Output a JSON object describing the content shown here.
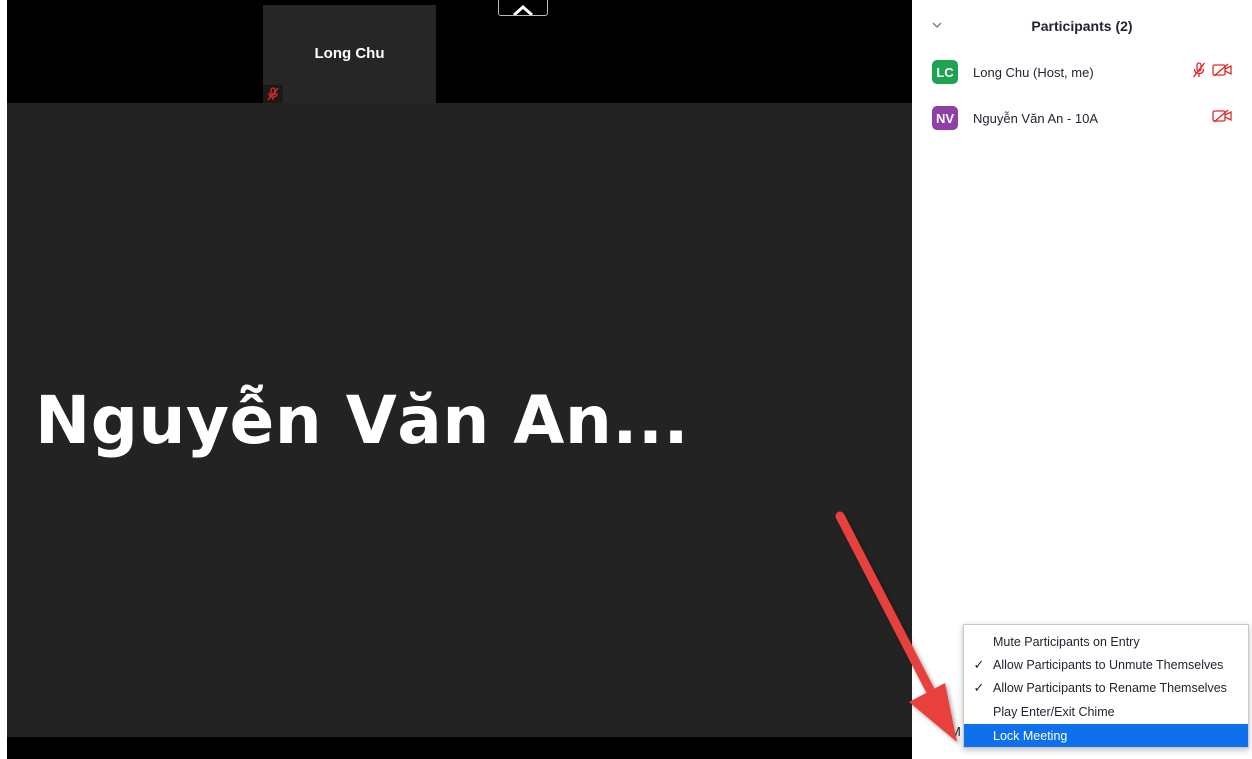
{
  "video": {
    "thumbnail_name": "Long Chu",
    "active_speaker_name": "Nguyễn Văn An..."
  },
  "participants_panel": {
    "title": "Participants (2)",
    "participants": [
      {
        "initials": "LC",
        "name": "Long Chu (Host, me)",
        "avatar_color": "#1da351",
        "muted": true,
        "video_off": true
      },
      {
        "initials": "NV",
        "name": "Nguyễn Văn An - 10A",
        "avatar_color": "#8e3fa8",
        "muted": false,
        "video_off": true
      }
    ],
    "more_button_partial": "M"
  },
  "more_menu": {
    "items": [
      {
        "label": "Mute Participants on Entry",
        "checked": ""
      },
      {
        "label": "Allow Participants to Unmute Themselves",
        "checked": "✓"
      },
      {
        "label": "Allow Participants to Rename Themselves",
        "checked": "✓"
      },
      {
        "label": "Play Enter/Exit Chime",
        "checked": ""
      },
      {
        "label": "Lock Meeting",
        "checked": "",
        "highlighted": true
      }
    ]
  },
  "colors": {
    "accent": "#0e71eb",
    "muted_icon": "#e02828",
    "arrow": "#e8403c"
  },
  "icons": [
    "mic-muted-icon",
    "video-off-icon",
    "chevron-down-icon",
    "check-icon"
  ]
}
